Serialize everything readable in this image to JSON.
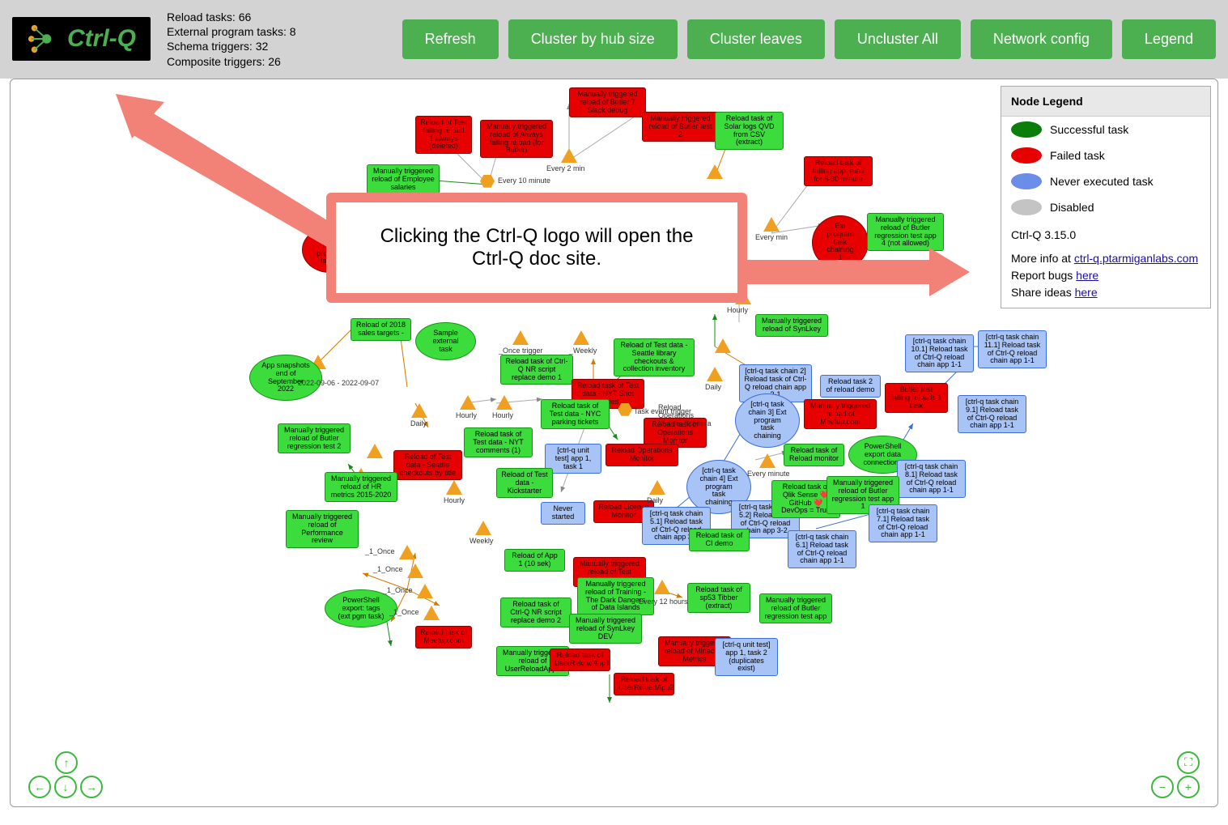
{
  "header": {
    "logo_text": "Ctrl-Q",
    "stats": {
      "reload": "Reload tasks: 66",
      "external": "External program tasks: 8",
      "schema": "Schema triggers: 32",
      "composite": "Composite triggers: 26"
    },
    "buttons": {
      "refresh": "Refresh",
      "cluster_hub": "Cluster by hub size",
      "cluster_leaves": "Cluster leaves",
      "uncluster": "Uncluster All",
      "network_config": "Network config",
      "legend": "Legend"
    }
  },
  "legend": {
    "title": "Node Legend",
    "items": {
      "success": "Successful task",
      "failed": "Failed task",
      "never": "Never executed task",
      "disabled": "Disabled"
    },
    "version": "Ctrl-Q 3.15.0",
    "more_info_prefix": "More info at ",
    "more_info_link": "ctrl-q.ptarmiganlabs.com",
    "report_bugs_prefix": "Report bugs ",
    "report_bugs_link": "here",
    "share_ideas_prefix": "Share ideas ",
    "share_ideas_link": "here"
  },
  "callout": {
    "text": "Clicking the Ctrl-Q logo will open the Ctrl-Q doc site."
  },
  "nodes": {
    "n1": "Manually triggered reload of Butler 7 Slack debug",
    "n2": "Manually triggered reload of Butler test 2",
    "n3": "Reload of Test failing reload 1 always (deleted)",
    "n4": "Manually triggered reload of Always failing reload (for Butler)",
    "n5": "Reload task of Solar logs QVD from CSV (extract)",
    "n6": "Every 2 min",
    "n7": "Reload task of failing app, runs for 5-30 minute",
    "n8": "Manually triggered reload of Employee salaries",
    "n9": "Every 10 minute",
    "n10": "Every min",
    "n11": "Ext program task chaining 1",
    "n12": "Manually triggered reload of Butler regression test app 4 (not allowed)",
    "n13": "Node-RED program task 1",
    "n14": "Hourly",
    "n15": "Manually triggered reload of SynLkey",
    "n16": "Reload of 2018 sales targets -",
    "n17": "Sample external task",
    "n18": "_Once trigger",
    "n19": "_Weekly",
    "n20": "Reload of Test data - Seattle library checkouts & collection inventory",
    "n21": "[ctrl-q task chain 11.1] Reload task of Ctrl-Q reload chain app 1-1",
    "n22": "[ctrl-q task chain 10.1] Reload task of Ctrl-Q reload chain app 1-1",
    "n23": "App snapshots end of September 2022",
    "n24": "2022-09-06 - 2022-09-07",
    "n25": "Reload task of Ctrl-Q NR script replace demo 1",
    "n26": "Reload task of Test data - NYT Shot stories",
    "n27": "Daily",
    "n28": "[ctrl-q task chain 2] Reload task of Ctrl-Q reload chain app 2-1",
    "n29": "Reload task 2 of reload demo",
    "n30": "Butler test failing reloads 1 task",
    "n31": "[ctrl-q task chain 9.1] Reload task of Ctrl-Q reload chain app 1-1",
    "n32": "Daily",
    "n33": "Hourly",
    "n34": "Hourly",
    "n35": "Reload task of Test data - NYC parking tickets",
    "n36": "Task event trigger",
    "n37": "Reload Operations Monitor Schema",
    "n38": "[ctrl-q task chain 3] Ext program task chaining",
    "n39": "Manually triggered reload of Meetup.com",
    "n40": "Reload task of Operations Monitor",
    "n41": "Manually triggered reload of Butler regression test 2",
    "n42": "Reload of Test data - Seattle checkouts by title",
    "n43": "Reload task of Test data - NYT comments (1)",
    "n44": "[ctrl-q unit test] app 1, task 1",
    "n45": "Reload Operations Monitor",
    "n46": "[ctrl-q task chain 4] Ext program task chaining",
    "n47": "Every minute",
    "n48": "Reload task of Reload monitor",
    "n49": "PowerShell export data connections",
    "n50": "[ctrl-q task chain 8.1] Reload task of Ctrl-Q reload chain app 1-1",
    "n51": "Manually triggered reload of HR metrics 2015-2020",
    "n52": "Reload of Test data - Kickstarter",
    "n53": "Never started",
    "n54": "Reload License Monitor",
    "n55": "Daily",
    "n56": "[ctrl-q task chain 5.1] Reload task of Ctrl-Q reload chain app 3-1",
    "n57": "[ctrl-q task chain 5.2] Reload task of Ctrl-Q reload chain app 3-2",
    "n58": "Reload task of Qlik Sense ❤️ GitHub ❤️ DevOps = True",
    "n59": "Manually triggered reload of Butler regression test app 1",
    "n60": "[ctrl-q task chain 7.1] Reload task of Ctrl-Q reload chain app 1-1",
    "n61": "Hourly",
    "n62": "Manually triggered reload of Performance review",
    "n63": "Weekly",
    "n64": "Reload task of CI demo",
    "n65": "[ctrl-q task chain 6.1] Reload task of Ctrl-Q reload chain app 1-1",
    "n66": "_1_Once",
    "n67": "_1_Once",
    "n68": "_1_Once",
    "n69": "_1_Once",
    "n70": "Reload of App 1 (10 sek)",
    "n71": "Manually triggered reload of Test failing reloads 2",
    "n72": "Every 12 hours",
    "n73": "Reload task of sp53 Tibber (extract)",
    "n74": "Manually triggered reload of Butler regression test app",
    "n75": "PowerShell export: tags (ext pgm task)",
    "n76": "Reload task of Ctrl-Q NR script replace demo 2",
    "n77": "Manually triggered reload of Training - The Dark Dangers of Data Islands",
    "n78": "Manually triggered reload of SynLkey DEV",
    "n79": "Reload task of Meetup.com",
    "n80": "Manually triggered reload of Minecraft Metrics",
    "n81": "[ctrl-q unit test] app 1, task 2 (duplicates exist)",
    "n82": "Manually triggered reload of UserReloadApp1",
    "n83": "Reload task of UserReloadApp1",
    "n84": "Reload task of UserReloadApp2"
  }
}
